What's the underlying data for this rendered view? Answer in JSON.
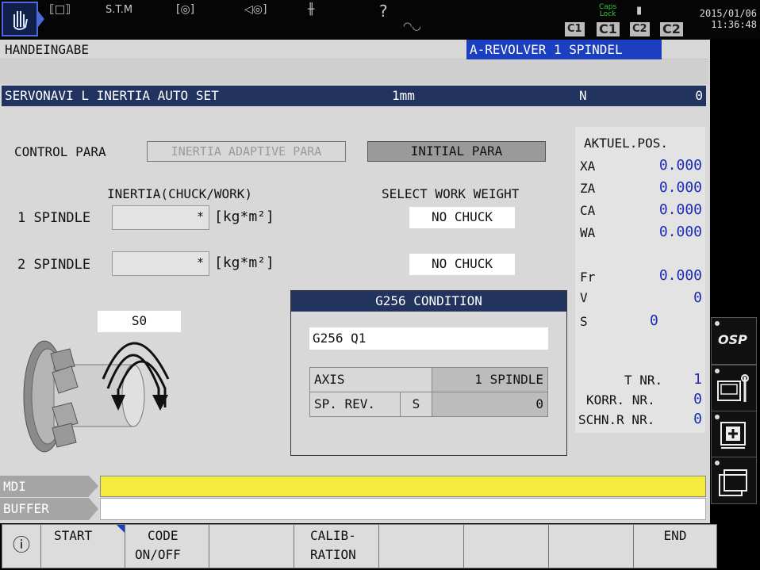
{
  "topbar": {
    "stm_label": "S.T.M",
    "help_glyph": "?",
    "caps_lock": "Caps\nLock",
    "c1_small": "C1",
    "c1": "C1",
    "c2_small": "C2",
    "c2": "C2",
    "date": "2015/01/06",
    "time": "11:36:48"
  },
  "mode_label": "HANDEINGABE",
  "turret_label": "A-REVOLVER 1 SPINDEL",
  "title": {
    "name": "SERVONAVI L INERTIA AUTO SET",
    "unit": "1mm",
    "n_label": "N",
    "n_value": "0"
  },
  "control_para": {
    "label": "CONTROL PARA",
    "option_adaptive": "INERTIA ADAPTIVE PARA",
    "option_initial": "INITIAL PARA"
  },
  "inertia": {
    "header": "INERTIA(CHUCK/WORK)",
    "select_header": "SELECT WORK WEIGHT",
    "rows": [
      {
        "label": "1 SPINDLE",
        "value": "*",
        "unit": "[kg*m²]",
        "weight": "NO CHUCK"
      },
      {
        "label": "2 SPINDLE",
        "value": "*",
        "unit": "[kg*m²]",
        "weight": "NO CHUCK"
      }
    ]
  },
  "spindle_cmd": "S0",
  "g256": {
    "title": "G256 CONDITION",
    "command": "G256 Q1",
    "axis_label": "AXIS",
    "axis_value": "1 SPINDLE",
    "sprev_label": "SP. REV.",
    "sprev_unit": "S",
    "sprev_value": "0"
  },
  "position": {
    "title": "AKTUEL.POS.",
    "axes": [
      {
        "label": "XA",
        "value": "0.000"
      },
      {
        "label": "ZA",
        "value": "0.000"
      },
      {
        "label": "CA",
        "value": "0.000"
      },
      {
        "label": "WA",
        "value": "0.000"
      }
    ],
    "fr_label": "Fr",
    "fr_value": "0.000",
    "v_label": "V",
    "v_value": "0",
    "s_label": "S",
    "s_value": "0",
    "t_label": "T NR.",
    "t_value": "1",
    "korr_label": "KORR. NR.",
    "korr_value": "0",
    "schn_label": "SCHN.R NR.",
    "schn_value": "0"
  },
  "right_icons": {
    "osp": "OSP"
  },
  "mdi_label": "MDI",
  "buffer_label": "BUFFER",
  "fkeys": {
    "info_glyph": "ⓘ",
    "start": "START",
    "code_1": "CODE",
    "code_2": "ON/OFF",
    "calib_1": "CALIB-",
    "calib_2": "RATION",
    "end": "END"
  },
  "colors": {
    "title_bar": "#22335f",
    "turret_bar": "#1b3fbf",
    "mdi_yellow": "#f4eb3c",
    "value_blue": "#1d2cb5"
  }
}
